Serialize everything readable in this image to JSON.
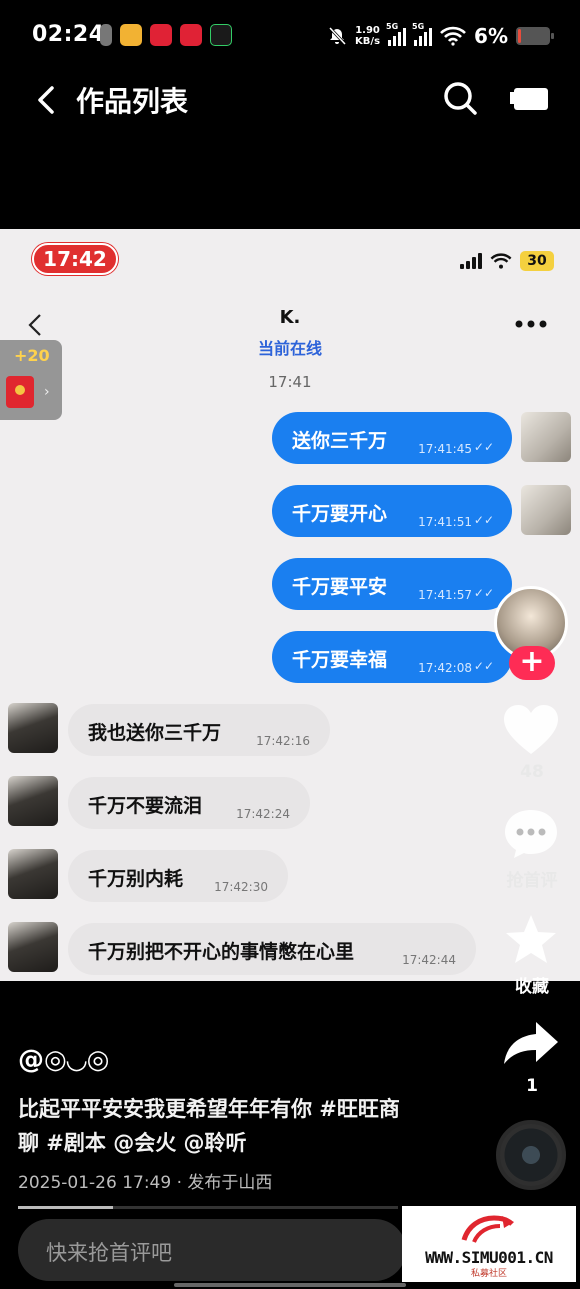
{
  "status_bar": {
    "time": "02:24",
    "net_speed_value": "1.90",
    "net_speed_unit": "KB/s",
    "sim1_label": "5G",
    "sim2_label": "5G",
    "battery_percent": "6%",
    "battery_level": 0.06,
    "app_icons": [
      "notification-icon",
      "mail-app-icon",
      "xiaohongshu-app-icon",
      "pinduoduo-app-icon",
      "app-icon"
    ]
  },
  "header": {
    "title": "作品列表"
  },
  "video": {
    "screenshot_status": {
      "time": "17:42",
      "battery": "30"
    },
    "chat": {
      "contact_name": "K.",
      "contact_status": "当前在线",
      "time_divider": "17:41",
      "outgoing": [
        {
          "text": "送你三千万",
          "time": "17:41:45"
        },
        {
          "text": "千万要开心",
          "time": "17:41:51"
        },
        {
          "text": "千万要平安",
          "time": "17:41:57"
        },
        {
          "text": "千万要幸福",
          "time": "17:42:08"
        }
      ],
      "incoming": [
        {
          "text": "我也送你三千万",
          "time": "17:42:16"
        },
        {
          "text": "千万不要流泪",
          "time": "17:42:24"
        },
        {
          "text": "千万别内耗",
          "time": "17:42:30"
        },
        {
          "text": "千万别把不开心的事情憋在心里",
          "time": "17:42:44"
        }
      ]
    },
    "red_packet": {
      "bonus": "+20"
    }
  },
  "rail": {
    "likes": "48",
    "comment_label": "抢首评",
    "favorite_label": "收藏",
    "shares": "1",
    "follow_symbol": "+"
  },
  "post": {
    "author": "@◎◡◎",
    "caption": "比起平平安安我更希望年年有你 #旺旺商聊 #剧本 @会火 @聆听",
    "meta": "2025-01-26 17:49 · 发布于山西",
    "progress": 0.25
  },
  "comment": {
    "placeholder": "快来抢首评吧"
  },
  "watermark": {
    "site": "WWW.SIMU001.CN",
    "sub": "私募社区"
  },
  "colors": {
    "accent_blue": "#1a7ff0",
    "follow_red": "#fe2c55",
    "online_blue": "#2d63d9"
  }
}
